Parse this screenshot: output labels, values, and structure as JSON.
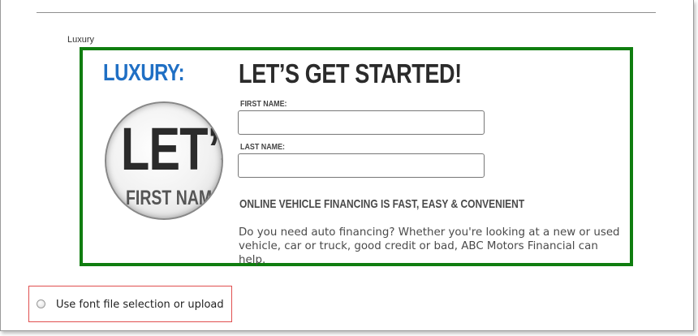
{
  "option_label": "Luxury",
  "preview": {
    "font_name_heading": "LUXURY:",
    "thumbnail": {
      "big_text": "LET’S",
      "small_text": "FIRST NAME"
    },
    "form_title": "LET’S GET STARTED!",
    "fields": [
      {
        "label": "FIRST NAME:",
        "value": ""
      },
      {
        "label": "LAST NAME:",
        "value": ""
      }
    ],
    "subheading": "ONLINE VEHICLE FINANCING IS FAST, EASY & CONVENIENT",
    "body": "Do you need auto financing? Whether you're looking at a new or used vehicle, car or truck, good credit or bad, ABC Motors Financial can help.",
    "border_color": "#0f7d0f",
    "heading_color": "#1f6fc4"
  },
  "radio_option": {
    "label": "Use font file selection or upload",
    "checked": false,
    "highlight_color": "#e05050"
  }
}
